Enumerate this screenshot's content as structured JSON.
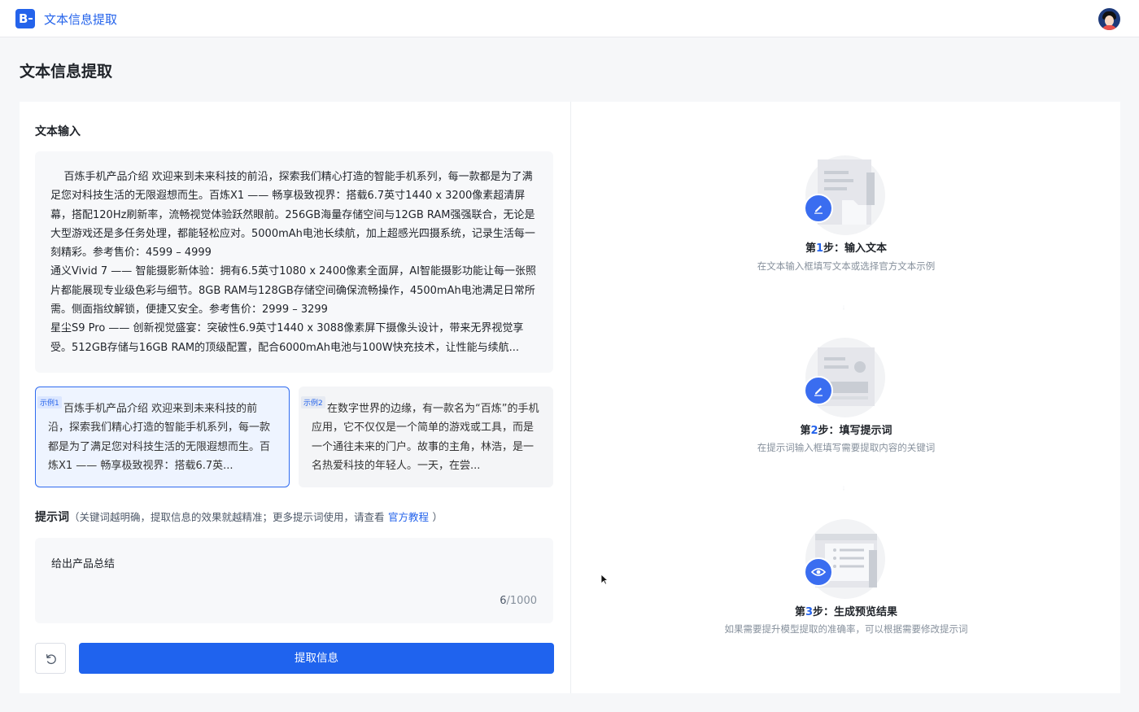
{
  "app": {
    "logo_letter": "B",
    "title": "文本信息提取"
  },
  "page": {
    "title": "文本信息提取"
  },
  "input_section": {
    "title": "文本输入",
    "text": "    百炼手机产品介绍 欢迎来到未来科技的前沿，探索我们精心打造的智能手机系列，每一款都是为了满足您对科技生活的无限遐想而生。百炼X1 —— 畅享极致视界：搭载6.7英寸1440 x 3200像素超清屏幕，搭配120Hz刷新率，流畅视觉体验跃然眼前。256GB海量存储空间与12GB RAM强强联合，无论是大型游戏还是多任务处理，都能轻松应对。5000mAh电池长续航，加上超感光四摄系统，记录生活每一刻精彩。参考售价：4599 – 4999\n通义Vivid 7 —— 智能摄影新体验：拥有6.5英寸1080 x 2400像素全面屏，AI智能摄影功能让每一张照片都能展现专业级色彩与细节。8GB RAM与128GB存储空间确保流畅操作，4500mAh电池满足日常所需。侧面指纹解锁，便捷又安全。参考售价：2999 – 3299\n星尘S9 Pro —— 创新视觉盛宴：突破性6.9英寸1440 x 3088像素屏下摄像头设计，带来无界视觉享受。512GB存储与16GB RAM的顶级配置，配合6000mAh电池与100W快充技术，让性能与续航..."
  },
  "examples": [
    {
      "tag": "示例1",
      "text": "百炼手机产品介绍 欢迎来到未来科技的前沿，探索我们精心打造的智能手机系列，每一款都是为了满足您对科技生活的无限遐想而生。百炼X1 —— 畅享极致视界：搭载6.7英..."
    },
    {
      "tag": "示例2",
      "text": "在数字世界的边缘，有一款名为“百炼”的手机应用，它不仅仅是一个简单的游戏或工具，而是一个通往未来的门户。故事的主角，林浩，是一名热爱科技的年轻人。一天，在尝..."
    }
  ],
  "prompt": {
    "label": "提示词",
    "hint": "（关键词越明确，提取信息的效果就越精准；更多提示词使用，请查看",
    "link": "官方教程",
    "hint_end": "）",
    "value": "给出产品总结",
    "count": "6",
    "max": "/1000"
  },
  "actions": {
    "reset_icon": "reset-icon",
    "extract_label": "提取信息"
  },
  "steps": [
    {
      "prefix": "第",
      "num": "1",
      "suffix": "步：输入文本",
      "desc": "在文本输入框填写文本或选择官方文本示例",
      "icon": "edit-icon"
    },
    {
      "prefix": "第",
      "num": "2",
      "suffix": "步：填写提示词",
      "desc": "在提示词输入框填写需要提取内容的关键词",
      "icon": "edit-icon"
    },
    {
      "prefix": "第",
      "num": "3",
      "suffix": "步：生成预览结果",
      "desc": "如果需要提升模型提取的准确率，可以根据需要修改提示词",
      "icon": "eye-icon"
    }
  ],
  "colors": {
    "accent": "#2463eb",
    "button": "#1f63ee",
    "selected_border": "#2f6bf0"
  }
}
